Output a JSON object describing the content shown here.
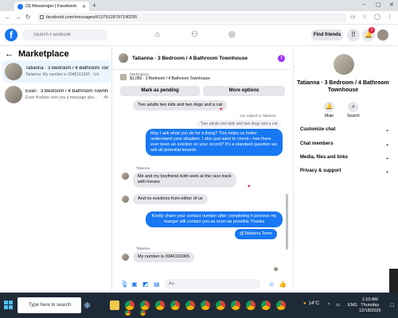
{
  "browser": {
    "tab_title": "(3) Messenger | Facebook",
    "url": "facebook.com/messages/t/1379128797190255"
  },
  "fbnav": {
    "search_placeholder": "Search Facebook",
    "find_friends": "Find friends",
    "notification_count": "2"
  },
  "left": {
    "title": "Marketplace",
    "conversations": [
      {
        "title": "Tatianna · 3 Bedroom / 4 Bathroom Townhouse",
        "preview": "Tatianna: My number is 3046161965 · 1m",
        "time": ""
      },
      {
        "title": "Evan · 3 Bedroom / 4 Bathroom Townhouse",
        "preview": "Evan Hodson sent you a message abo...",
        "time": "4h"
      }
    ]
  },
  "chat": {
    "title": "Tatianna · 3 Bedroom / 4 Bathroom Townhouse",
    "listing_tag": "Marketplace",
    "listing_price": "$1,050 · 3 Bedroom / 4 Bathroom Townhouse",
    "mark_pending": "Mark as pending",
    "more_options": "More options",
    "messages": {
      "m1": "Two adults two kids and two dogs and a cat",
      "replied_to": "You replied to Tatianna",
      "quote": "Two adults two kids and two dogs and a cat",
      "m2": "May I ask what you do for a living? This helps us better understand your situation. I also just want to check—has there ever been an eviction on your record? It's a standard question we ask all potential tenants.",
      "sender1": "Tatianna",
      "m3": "Me and my boyfriend both work at the race track with horses",
      "m4": "And no evictions from either of us",
      "m5": "Kindly share your contact number after completing h process my manger will contact you as soon as possible.Thanks",
      "mention": "@Tatianna Toms",
      "sender2": "Tatianna",
      "m6": "My number is 3046161965"
    },
    "composer_placeholder": "Aa"
  },
  "right": {
    "title": "Tatianna · 3 Bedroom / 4 Bathroom Townhouse",
    "mute": "Mute",
    "search": "Search",
    "rows": [
      "Customize chat",
      "Chat members",
      "Media, files and links",
      "Privacy & support"
    ]
  },
  "taskbar": {
    "search_placeholder": "Type here to search",
    "temperature": "14°C",
    "language": "ENG",
    "time": "1:10 AM",
    "day": "Thursday",
    "date": "12/18/2025"
  }
}
